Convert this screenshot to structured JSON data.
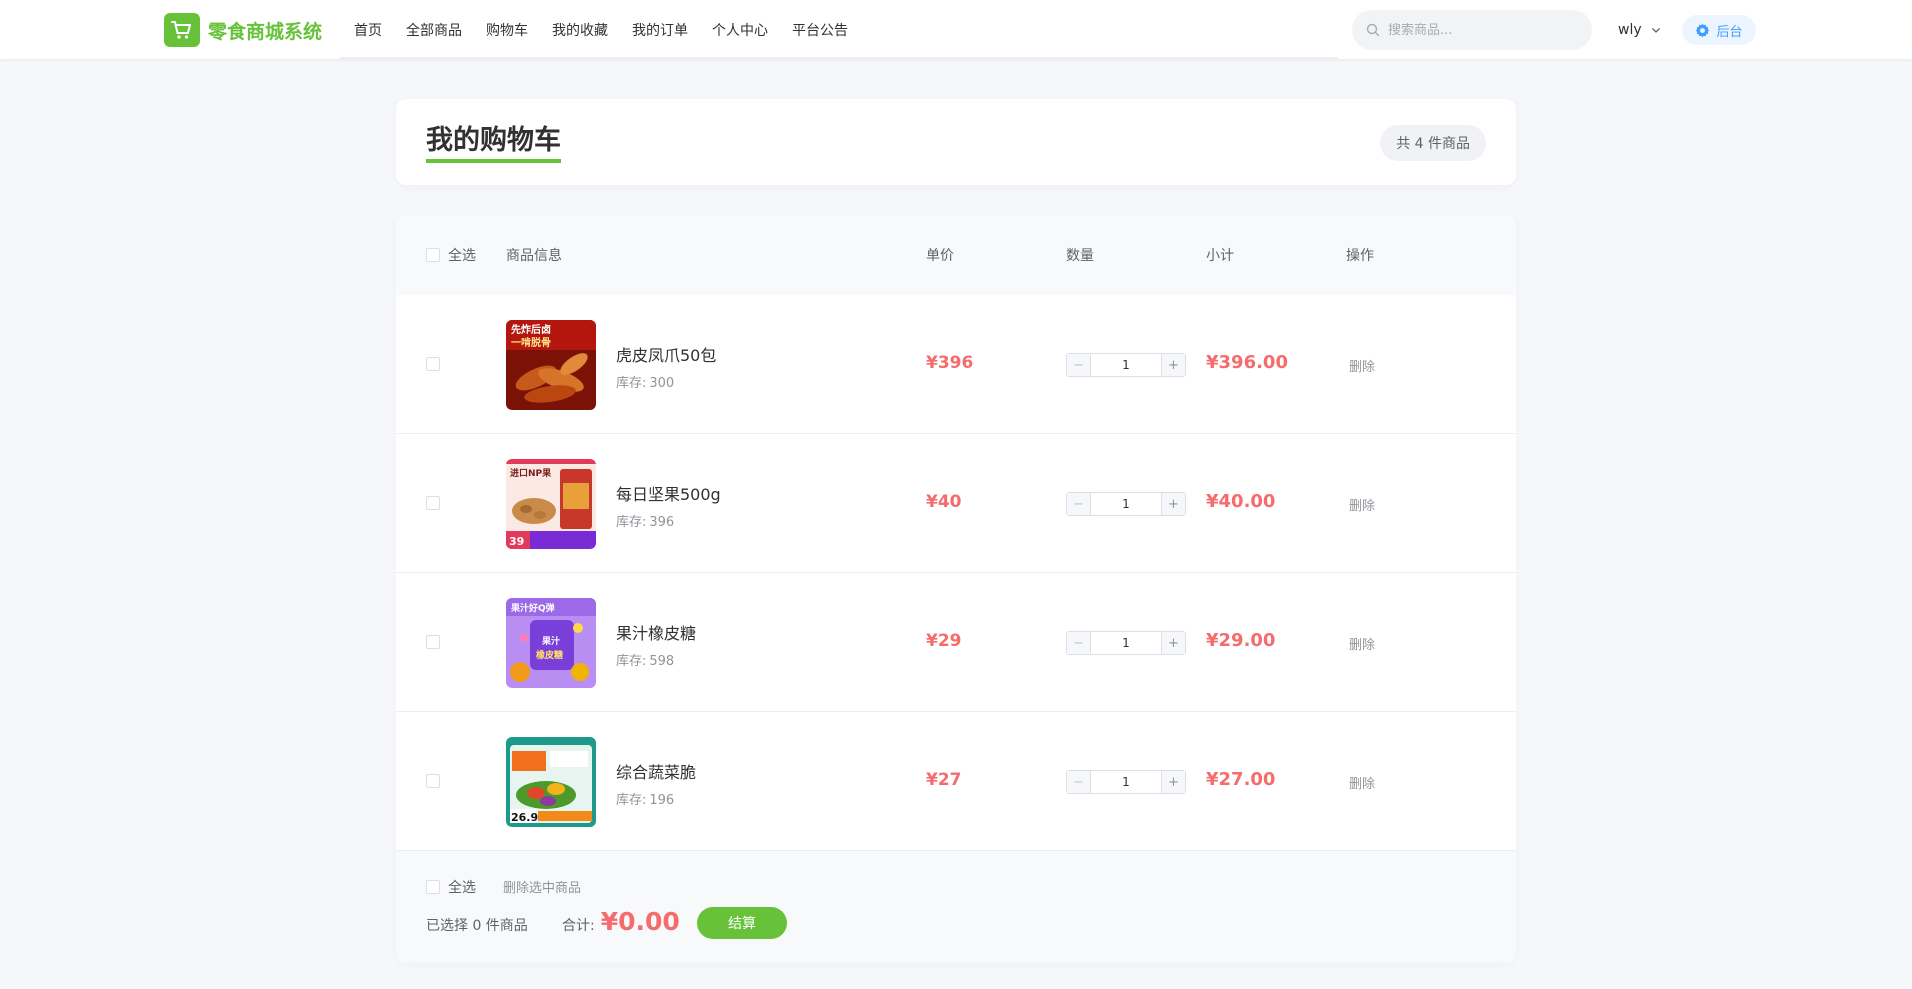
{
  "header": {
    "logo_text": "零食商城系统",
    "nav": [
      "首页",
      "全部商品",
      "购物车",
      "我的收藏",
      "我的订单",
      "个人中心",
      "平台公告"
    ],
    "search_placeholder": "搜索商品...",
    "username": "wly",
    "admin_label": "后台"
  },
  "cart": {
    "title": "我的购物车",
    "count_badge": "共 4 件商品",
    "columns": {
      "select_all": "全选",
      "info": "商品信息",
      "price": "单价",
      "qty": "数量",
      "subtotal": "小计",
      "action": "操作"
    },
    "stock_label": "库存:",
    "delete_label": "删除",
    "items": [
      {
        "name": "虎皮凤爪50包",
        "stock": "300",
        "price": "¥396",
        "qty": "1",
        "subtotal": "¥396.00"
      },
      {
        "name": "每日坚果500g",
        "stock": "396",
        "price": "¥40",
        "qty": "1",
        "subtotal": "¥40.00"
      },
      {
        "name": "果汁橡皮糖",
        "stock": "598",
        "price": "¥29",
        "qty": "1",
        "subtotal": "¥29.00"
      },
      {
        "name": "综合蔬菜脆",
        "stock": "196",
        "price": "¥27",
        "qty": "1",
        "subtotal": "¥27.00"
      }
    ],
    "footer": {
      "select_all": "全选",
      "delete_selected": "删除选中商品",
      "selected_info": "已选择 0 件商品",
      "total_label": "合计:",
      "total_value": "¥0.00",
      "checkout": "结算"
    }
  },
  "thumb_texts": {
    "item0": [
      "先炸后卤",
      "一啃脱骨"
    ],
    "item1": [
      "进口NP果",
      "39"
    ],
    "item2": [
      "果汁好Q弹",
      "果汁",
      "橡皮糖"
    ],
    "item3": [
      "26.9"
    ]
  },
  "colors": {
    "brand": "#67c23a",
    "price": "#f56c6c",
    "admin": "#409eff"
  }
}
